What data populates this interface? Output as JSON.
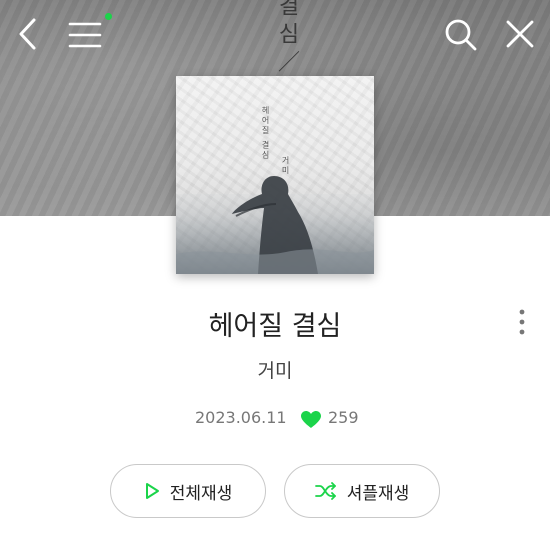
{
  "hero": {
    "vertical_text": "결심／거"
  },
  "header": {
    "back_icon": "chevron-left-icon",
    "menu_icon": "hamburger-menu-icon",
    "notification_dot_color": "#1bd44a",
    "search_icon": "search-icon",
    "close_icon": "close-icon"
  },
  "album": {
    "cover_title": "헤어질 결심",
    "cover_artist": "거미",
    "title": "헤어질 결심",
    "artist": "거미",
    "date": "2023.06.11",
    "likes": "259",
    "like_color": "#1bd44a"
  },
  "actions": {
    "play_all_label": "전체재생",
    "shuffle_label": "셔플재생",
    "accent": "#1bd44a"
  }
}
